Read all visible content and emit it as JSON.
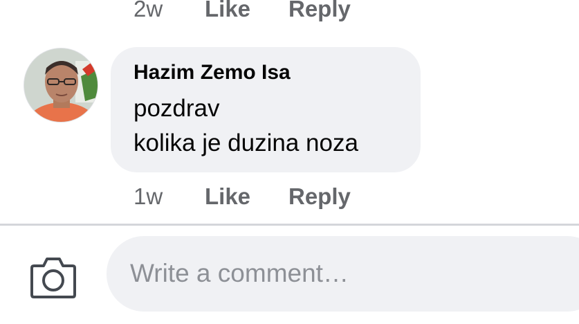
{
  "previous_comment": {
    "time": "2w",
    "like_label": "Like",
    "reply_label": "Reply"
  },
  "comment": {
    "author": "Hazim Zemo Isa",
    "lines": [
      "pozdrav",
      "kolika je duzina noza"
    ],
    "time": "1w",
    "like_label": "Like",
    "reply_label": "Reply"
  },
  "composer": {
    "placeholder": "Write a comment…"
  },
  "icons": {
    "camera": "camera-icon"
  },
  "colors": {
    "bubble": "#f0f1f4",
    "muted_text": "#65676b",
    "text": "#050505",
    "placeholder": "#8d9096"
  }
}
